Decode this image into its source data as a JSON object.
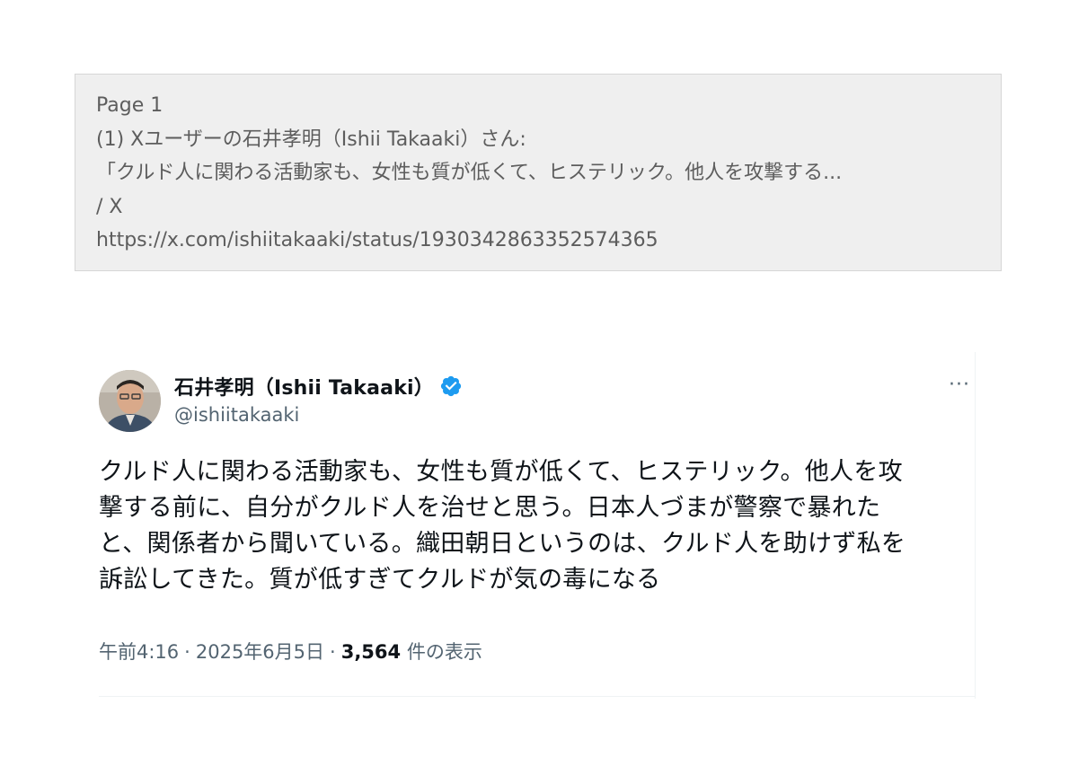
{
  "header": {
    "page_label": "Page 1",
    "title_line1": "(1) Xユーザーの石井孝明（Ishii Takaaki）さん:",
    "title_line2": "「クルド人に関わる活動家も、女性も質が低くて、ヒステリック。他人を攻撃する...",
    "title_line3": "/ X",
    "url": "https://x.com/ishiitakaaki/status/1930342863352574365"
  },
  "tweet": {
    "display_name": "石井孝明（Ishii Takaaki）",
    "handle": "@ishiitakaaki",
    "more_label": "···",
    "text_lines": [
      "クルド人に関わる活動家も、女性も質が低くて、ヒステリック。他人を攻",
      "撃する前に、自分がクルド人を治せと思う。日本人づまが警察で暴れた",
      "と、関係者から聞いている。織田朝日というのは、クルド人を助けず私を",
      "訴訟してきた。質が低すぎてクルドが気の毒になる"
    ],
    "time": "午前4:16",
    "dot": "·",
    "date": "2025年6月5日",
    "views_count": "3,564",
    "views_label": "件の表示",
    "verified_icon": "verified-badge-icon",
    "verified_color": "#1d9bf0"
  }
}
